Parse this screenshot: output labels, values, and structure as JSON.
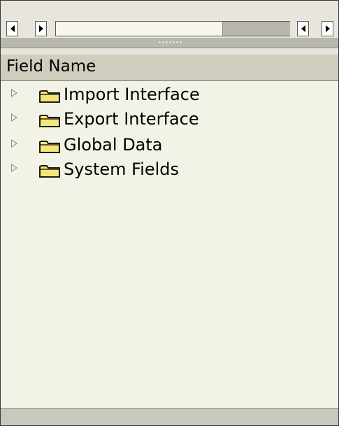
{
  "toolbar": {
    "buttons": [
      "nav-left",
      "nav-right",
      "nav-left-2",
      "nav-right-2"
    ]
  },
  "header": {
    "column_title": "Field Name"
  },
  "tree": {
    "items": [
      {
        "label": "Import Interface",
        "icon": "folder-icon",
        "expander": "collapsed-triangle"
      },
      {
        "label": "Export Interface",
        "icon": "folder-icon",
        "expander": "collapsed-triangle"
      },
      {
        "label": "Global Data",
        "icon": "folder-icon",
        "expander": "collapsed-triangle"
      },
      {
        "label": "System Fields",
        "icon": "folder-icon",
        "expander": "collapsed-triangle"
      }
    ]
  },
  "colors": {
    "panel_bg": "#e8e6dc",
    "tree_bg": "#f3f2e6",
    "header_bg": "#cfcdbe",
    "folder_fill": "#f5e67a"
  }
}
